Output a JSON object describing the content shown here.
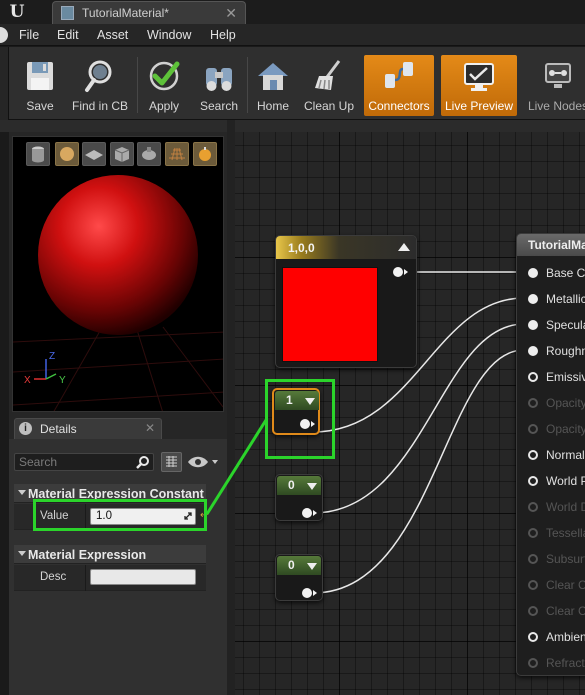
{
  "window": {
    "logo": "U",
    "tab_title": "TutorialMaterial*",
    "tab_close": "✕"
  },
  "menu": [
    "File",
    "Edit",
    "Asset",
    "Window",
    "Help"
  ],
  "toolbar": [
    {
      "label": "Save",
      "icon": "save-icon",
      "active": false
    },
    {
      "label": "Find in CB",
      "icon": "magnifier-icon",
      "active": false
    },
    {
      "label": "Apply",
      "icon": "checkmark-icon",
      "active": false
    },
    {
      "label": "Search",
      "icon": "binoculars-icon",
      "active": false
    },
    {
      "label": "Home",
      "icon": "home-icon",
      "active": false
    },
    {
      "label": "Clean Up",
      "icon": "broom-icon",
      "active": false
    },
    {
      "label": "Connectors",
      "icon": "connectors-icon",
      "active": true
    },
    {
      "label": "Live Preview",
      "icon": "monitor-icon",
      "active": true
    },
    {
      "label": "Live Nodes",
      "icon": "live-nodes-icon",
      "active": false
    }
  ],
  "viewport": {
    "axis_x": "X",
    "axis_y": "Y",
    "axis_z": "Z",
    "preview_color": "#e01010"
  },
  "details": {
    "tab_label": "Details",
    "tab_close": "✕",
    "search_placeholder": "Search",
    "category_constant": "Material Expression Constant",
    "value_label": "Value",
    "value": "1.0",
    "category_expression": "Material Expression",
    "desc_label": "Desc",
    "desc_value": ""
  },
  "graph": {
    "vector_node": {
      "title": "1,0,0",
      "color": "#ff0000"
    },
    "constants": [
      {
        "value": "1",
        "selected": true
      },
      {
        "value": "0",
        "selected": false
      },
      {
        "value": "0",
        "selected": false
      }
    ],
    "material_node": {
      "title": "TutorialMaterial",
      "pins": [
        {
          "label": "Base Color",
          "state": "on"
        },
        {
          "label": "Metallic",
          "state": "on"
        },
        {
          "label": "Specular",
          "state": "on"
        },
        {
          "label": "Roughness",
          "state": "on"
        },
        {
          "label": "Emissive Color",
          "state": "hollow"
        },
        {
          "label": "Opacity",
          "state": "off"
        },
        {
          "label": "Opacity Mask",
          "state": "off"
        },
        {
          "label": "Normal",
          "state": "hollow"
        },
        {
          "label": "World Position Offset",
          "state": "hollow"
        },
        {
          "label": "World Displacement",
          "state": "off"
        },
        {
          "label": "Tessellation Multiplier",
          "state": "off"
        },
        {
          "label": "Subsurface Color",
          "state": "off"
        },
        {
          "label": "Clear Coat",
          "state": "off"
        },
        {
          "label": "Clear Coat Roughness",
          "state": "off"
        },
        {
          "label": "Ambient Occlusion",
          "state": "hollow"
        },
        {
          "label": "Refraction",
          "state": "off"
        }
      ]
    }
  },
  "colors": {
    "accent_orange": "#e48a18",
    "highlight_green": "#2bd42b",
    "wire": "#e8e8e8"
  }
}
